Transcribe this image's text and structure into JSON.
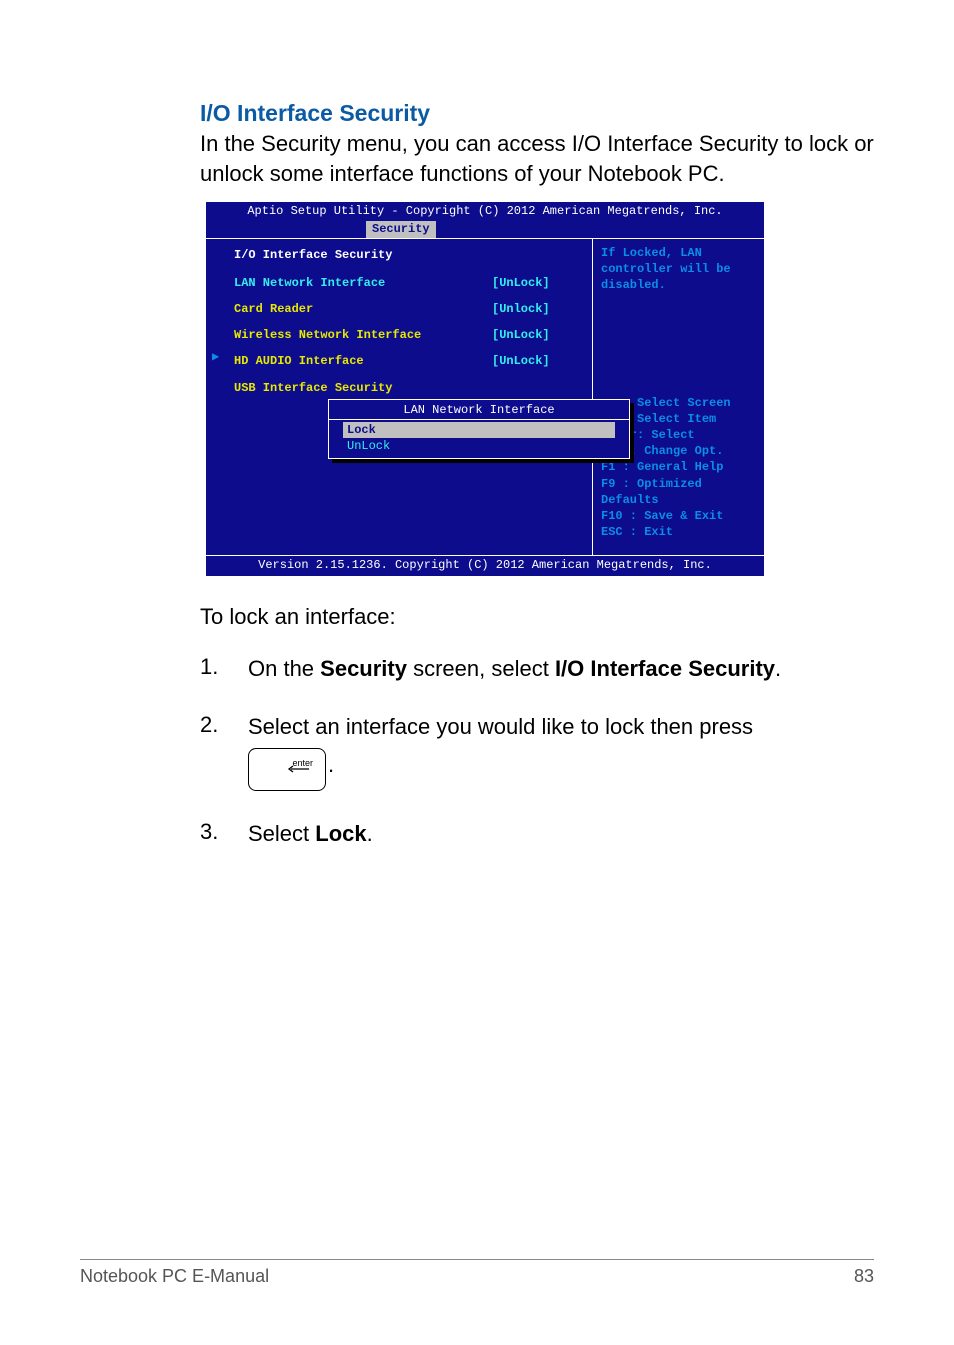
{
  "heading": "I/O Interface Security",
  "intro": "In the Security menu, you can access I/O Interface Security to lock or unlock some interface functions of your Notebook PC.",
  "bios": {
    "header": "Aptio Setup Utility - Copyright (C) 2012 American Megatrends, Inc.",
    "tab": "Security",
    "title": "I/O Interface Security",
    "items": [
      {
        "label": "LAN Network Interface",
        "value": "[UnLock]",
        "cls": "cyan"
      },
      {
        "label": "Card Reader",
        "value": "[Unlock]",
        "cls": "yellow"
      },
      {
        "label": "Wireless Network Interface",
        "value": "[UnLock]",
        "cls": "yellow"
      },
      {
        "label": "HD AUDIO Interface",
        "value": "[UnLock]",
        "cls": "yellow"
      },
      {
        "label": "USB Interface Security",
        "value": "",
        "cls": "yellow"
      }
    ],
    "popup": {
      "title": "LAN Network Interface",
      "options": [
        "Lock",
        "UnLock"
      ],
      "selected": 0
    },
    "help_top": "If Locked, LAN controller will be disabled.",
    "help_keys": [
      "→←  : Select Screen",
      "↑↓  : Select Item",
      "Enter: Select",
      "+/-  : Change Opt.",
      "F1   : General Help",
      "F9   : Optimized Defaults",
      "F10  : Save & Exit",
      "ESC  : Exit"
    ],
    "footer": "Version 2.15.1236. Copyright (C) 2012 American Megatrends, Inc."
  },
  "lock_intro": "To lock an interface:",
  "steps": {
    "s1_num": "1.",
    "s1_pre": "On the ",
    "s1_b1": "Security",
    "s1_mid": " screen, select ",
    "s1_b2": "I/O Interface Security",
    "s1_post": ".",
    "s2_num": "2.",
    "s2_text": "Select an interface you would like to lock then press",
    "s2_key_label": "enter",
    "s2_post": ".",
    "s3_num": "3.",
    "s3_pre": "Select ",
    "s3_b": "Lock",
    "s3_post": "."
  },
  "footer": {
    "left": "Notebook PC E-Manual",
    "right": "83"
  }
}
